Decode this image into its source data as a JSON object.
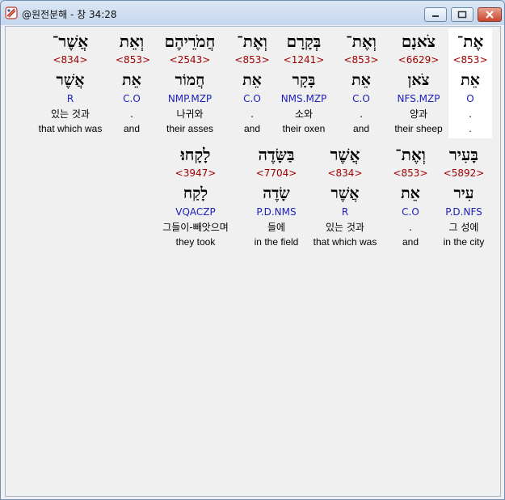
{
  "window": {
    "title": "@원전분해 - 창 34:28",
    "icon": "app-logo-icon",
    "controls": {
      "minimize": "minimize-icon",
      "maximize": "maximize-icon",
      "close": "close-icon"
    }
  },
  "colors": {
    "strong": "#a00000",
    "parse": "#1e22b8",
    "selected_bg": "#ffffff"
  },
  "lines": [
    {
      "words": [
        {
          "heb": "אֶת־",
          "strong": "<853>",
          "lemma": "אֵת",
          "parse": "O",
          "kor": ".",
          "eng": ".",
          "selected": true
        },
        {
          "heb": "צֹאנָם",
          "strong": "<6629>",
          "lemma": "צֹאן",
          "parse": "NFS.MZP",
          "kor": "양과",
          "eng": "their sheep",
          "selected": false
        },
        {
          "heb": "וְאֶת־",
          "strong": "<853>",
          "lemma": "אֵת",
          "parse": "C.O",
          "kor": ".",
          "eng": "and",
          "selected": false
        },
        {
          "heb": "בְּקָרָם",
          "strong": "<1241>",
          "lemma": "בָּקָר",
          "parse": "NMS.MZP",
          "kor": "소와",
          "eng": "their oxen",
          "selected": false
        },
        {
          "heb": "וְאֶת־",
          "strong": "<853>",
          "lemma": "אֵת",
          "parse": "C.O",
          "kor": ".",
          "eng": "and",
          "selected": false
        },
        {
          "heb": "חֲמֹרֵיהֶם",
          "strong": "<2543>",
          "lemma": "חֲמוֹר",
          "parse": "NMP.MZP",
          "kor": "나귀와",
          "eng": "their asses",
          "selected": false
        },
        {
          "heb": "וְאֵת",
          "strong": "<853>",
          "lemma": "אֵת",
          "parse": "C.O",
          "kor": ".",
          "eng": "and",
          "selected": false
        },
        {
          "heb": "אֲשֶׁר־",
          "strong": "<834>",
          "lemma": "אֲשֶׁר",
          "parse": "R",
          "kor": "있는 것과",
          "eng": "that which was",
          "selected": false
        }
      ]
    },
    {
      "words": [
        {
          "heb": "בָּעִיר",
          "strong": "<5892>",
          "lemma": "עִיר",
          "parse": "P.D.NFS",
          "kor": "그 성에",
          "eng": "in the city",
          "selected": false
        },
        {
          "heb": "וְאֶת־",
          "strong": "<853>",
          "lemma": "אֵת",
          "parse": "C.O",
          "kor": ".",
          "eng": "and",
          "selected": false
        },
        {
          "heb": "אֲשֶׁר",
          "strong": "<834>",
          "lemma": "אֲשֶׁר",
          "parse": "R",
          "kor": "있는 것과",
          "eng": "that which was",
          "selected": false
        },
        {
          "heb": "בַּשָּׂדֶה",
          "strong": "<7704>",
          "lemma": "שָׂדֶה",
          "parse": "P.D.NMS",
          "kor": "들에",
          "eng": "in the field",
          "selected": false
        },
        {
          "heb": "לָקָחוּ׃",
          "strong": "<3947>",
          "lemma": "לָקַח",
          "parse": "VQACZP",
          "kor": "그들이-빼앗으며",
          "eng": "they took",
          "selected": false
        }
      ]
    }
  ]
}
